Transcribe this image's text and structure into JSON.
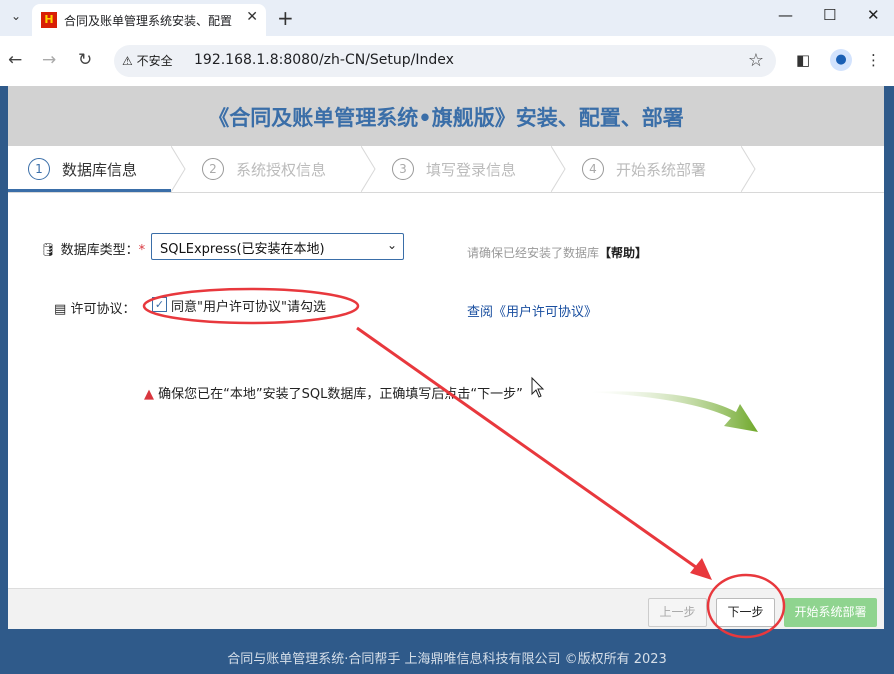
{
  "browser": {
    "tab_title": "合同及账单管理系统安装、配置",
    "favicon": "H",
    "insecure_label": "不安全",
    "url": "192.168.1.8:8080/zh-CN/Setup/Index"
  },
  "page": {
    "title": "《合同及账单管理系统•旗舰版》安装、配置、部署",
    "steps": [
      {
        "num": "1",
        "label": "数据库信息"
      },
      {
        "num": "2",
        "label": "系统授权信息"
      },
      {
        "num": "3",
        "label": "填写登录信息"
      },
      {
        "num": "4",
        "label": "开始系统部署"
      }
    ],
    "db_type_label": "数据库类型：",
    "required_mark": "*",
    "db_type_value": "SQLExpress(已安装在本地)",
    "hint_text": "请确保已经安装了数据库",
    "help_label": "【帮助】",
    "license_label": "许可协议：",
    "agree_text": "同意\"用户许可协议\"请勾选",
    "license_link": "查阅《用户许可协议》",
    "warning": "确保您已在“本地”安装了SQL数据库，正确填写后点击“下一步”",
    "buttons": {
      "prev": "上一步",
      "next": "下一步",
      "deploy": "开始系统部署"
    },
    "copyright": "合同与账单管理系统·合同帮手  上海鼎唯信息科技有限公司 ©版权所有 2023"
  },
  "colors": {
    "accent": "#3a6ea8",
    "annotation": "#e8383d",
    "deploy": "#8fd48f"
  }
}
